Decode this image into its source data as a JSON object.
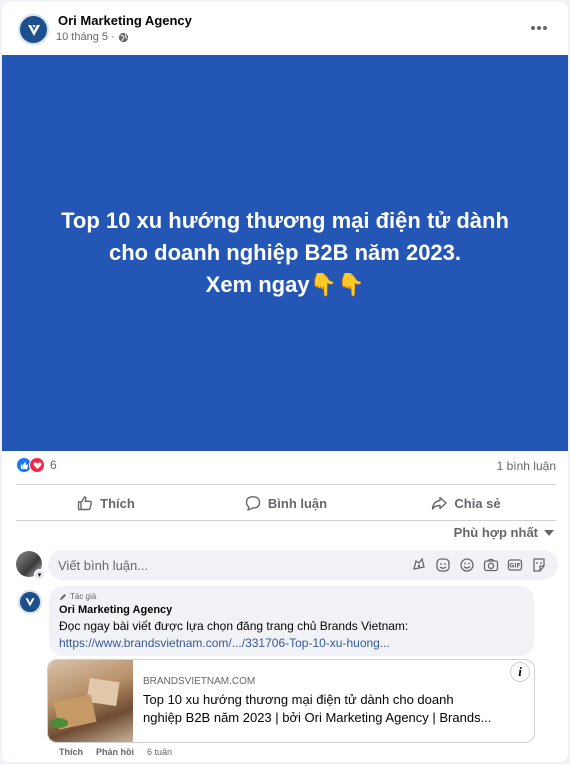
{
  "post": {
    "page_name": "Ori Marketing Agency",
    "date": "10 tháng 5",
    "separator": "·",
    "avatar_icon": "ori-logo-icon",
    "more_icon": "more-options-icon",
    "privacy_icon": "globe-icon"
  },
  "banner": {
    "line1": "Top 10 xu hướng thương mại điện tử dành",
    "line2": "cho doanh nghiệp B2B năm 2023.",
    "line3": "Xem ngay👇👇",
    "background": "#2456b5"
  },
  "stats": {
    "reaction_count": "6",
    "comment_count": "1 bình luận",
    "reaction_icons": [
      "like-reaction-icon",
      "love-reaction-icon"
    ]
  },
  "actions": {
    "like_label": "Thích",
    "comment_label": "Bình luận",
    "share_label": "Chia sẻ"
  },
  "sort": {
    "label": "Phù hợp nhất"
  },
  "composer": {
    "placeholder": "Viết bình luận...",
    "icons": [
      "avatar-sticker-icon",
      "sticker-icon",
      "emoji-icon",
      "camera-icon",
      "gif-icon",
      "sticker-pack-icon"
    ]
  },
  "comment": {
    "author_tag": "Tác giả",
    "author_name": "Ori Marketing Agency",
    "text": "Đọc ngay bài viết được lựa chọn đăng trang chủ Brands Vietnam:",
    "link": "https://www.brandsvietnam.com/.../331706-Top-10-xu-huong...",
    "like_label": "Thích",
    "reply_label": "Phản hồi",
    "time": "6 tuần"
  },
  "link_preview": {
    "domain": "BRANDSVIETNAM.COM",
    "title_line1": "Top 10 xu hướng thương mại điện tử dành cho doanh",
    "title_line2": "nghiệp B2B năm 2023 | bởi Ori Marketing Agency | Brands...",
    "info_label": "i"
  },
  "colors": {
    "accent": "#1877f2",
    "love": "#f02849",
    "link": "#385898",
    "secondary_text": "#65676b"
  }
}
